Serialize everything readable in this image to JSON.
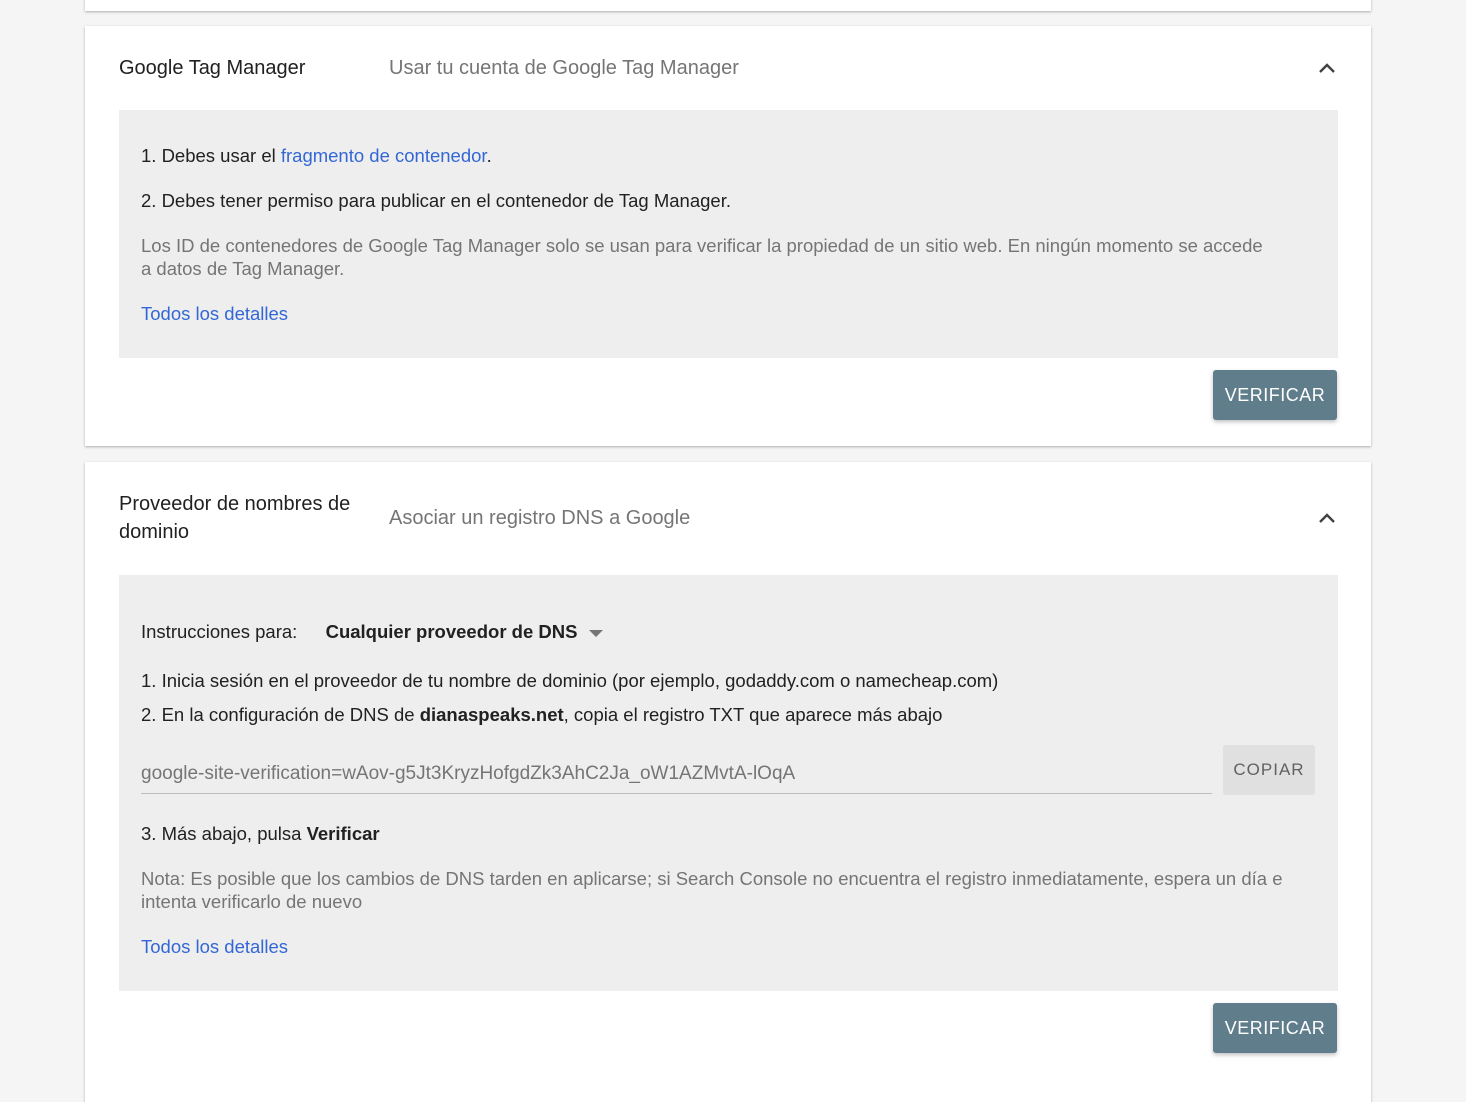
{
  "gtm": {
    "title": "Google Tag Manager",
    "subtitle": "Usar tu cuenta de Google Tag Manager",
    "step1_prefix": "1. Debes usar el ",
    "step1_link": "fragmento de contenedor",
    "step1_suffix": ".",
    "step2": "2. Debes tener permiso para publicar en el contenedor de Tag Manager.",
    "note": "Los ID de contenedores de Google Tag Manager solo se usan para verificar la propiedad de un sitio web. En ningún momento se accede a datos de Tag Manager.",
    "details_link": "Todos los detalles",
    "verify_label": "VERIFICAR",
    "chevron_icon": "chevron-up-icon"
  },
  "dns": {
    "title_line1": "Proveedor de nombres de",
    "title_line2": "dominio",
    "subtitle": "Asociar un registro DNS a Google",
    "instructions_label": "Instrucciones para:",
    "provider_selected": "Cualquier proveedor de DNS",
    "step1": "1. Inicia sesión en el proveedor de tu nombre de dominio (por ejemplo, godaddy.com o namecheap.com)",
    "step2_prefix": "2. En la configuración de DNS de ",
    "step2_domain": "dianaspeaks.net",
    "step2_suffix": ", copia el registro TXT que aparece más abajo",
    "txt_record": "google-site-verification=wAov-g5Jt3KryzHofgdZk3AhC2Ja_oW1AZMvtA-lOqA",
    "copy_label": "COPIAR",
    "step3_prefix": "3. Más abajo, pulsa ",
    "step3_bold": "Verificar",
    "note": "Nota: Es posible que los cambios de DNS tarden en aplicarse; si Search Console no encuentra el registro inmediatamente, espera un día e intenta verificarlo de nuevo",
    "details_link": "Todos los detalles",
    "verify_label": "VERIFICAR",
    "chevron_icon": "chevron-up-icon"
  },
  "colors": {
    "accent_link": "#3367d6",
    "verify_button": "#607d8b",
    "panel_bg": "#eeeeee"
  }
}
